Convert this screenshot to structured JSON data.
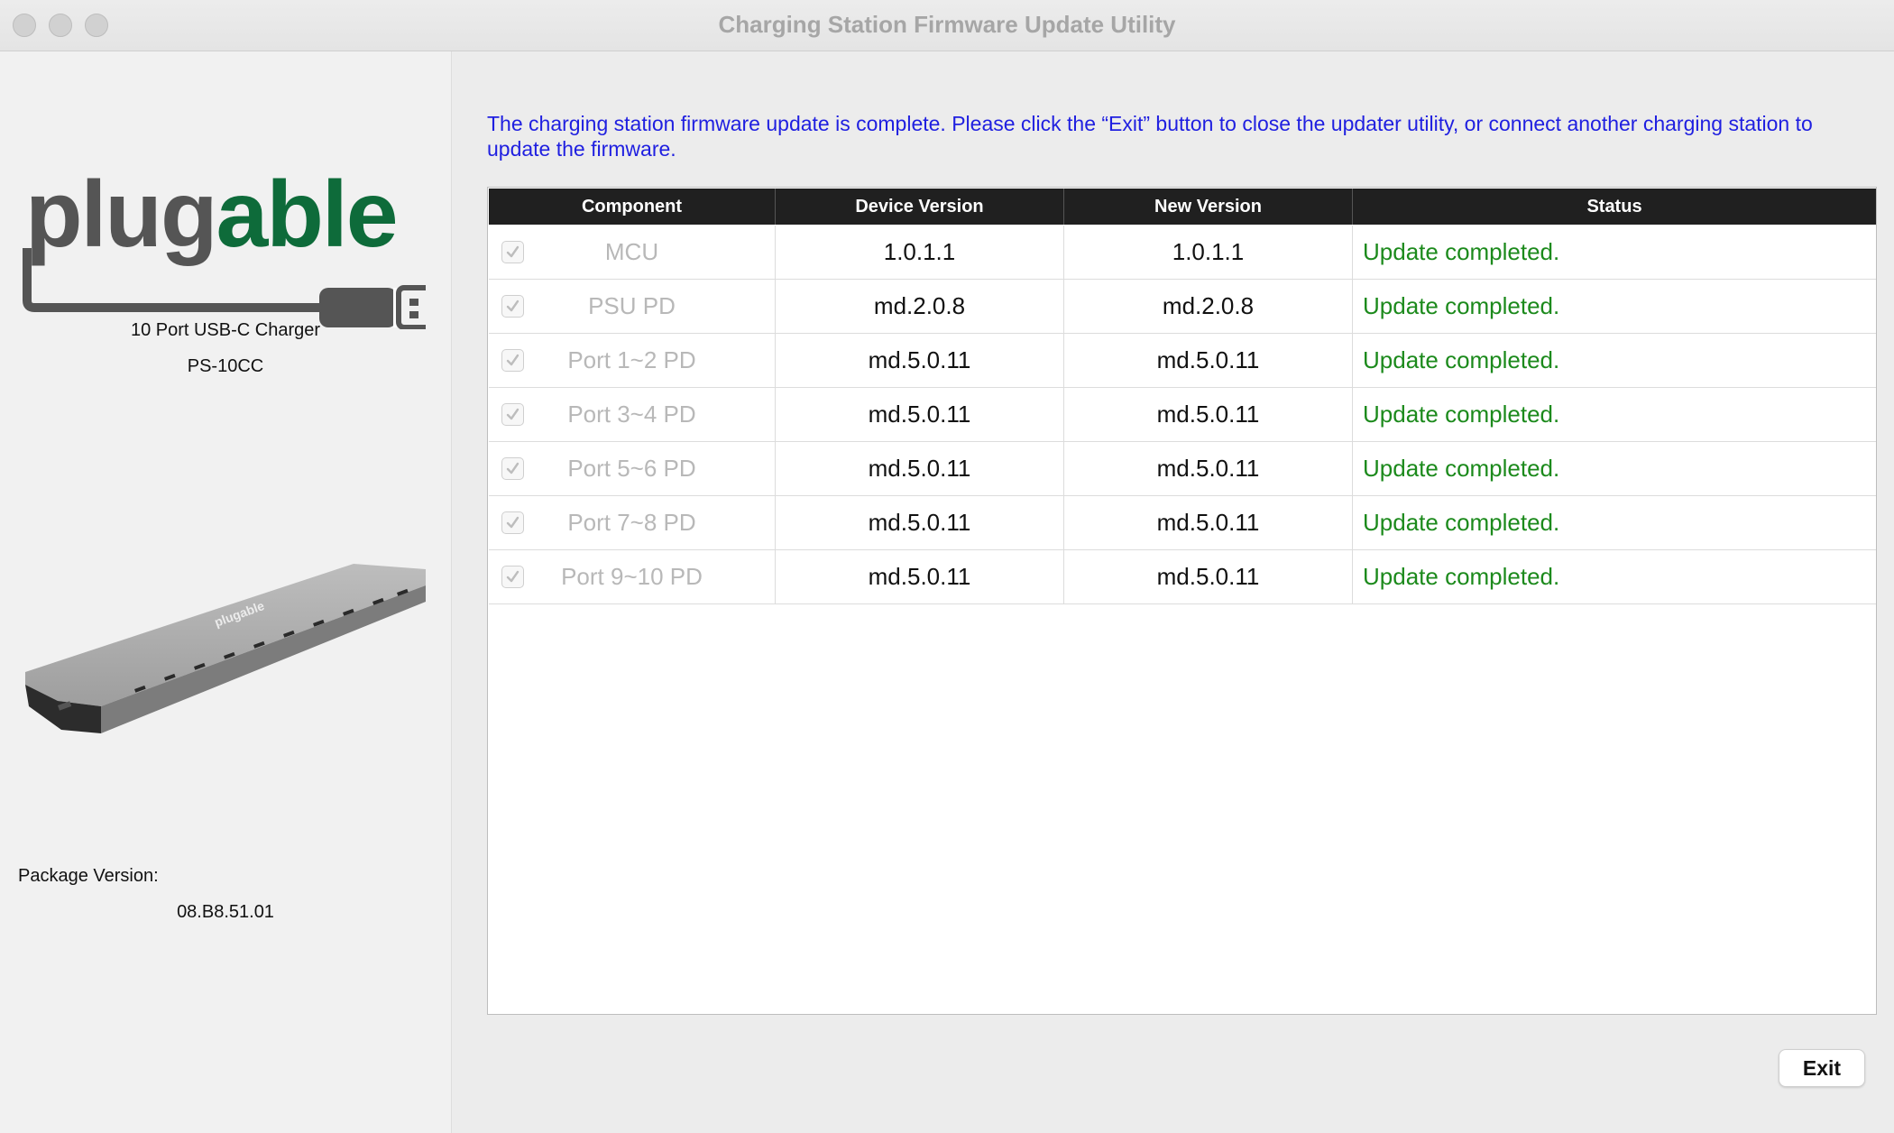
{
  "window": {
    "title": "Charging Station Firmware Update Utility"
  },
  "sidebar": {
    "brand": "plugable",
    "product_name": "10 Port USB-C Charger",
    "model": "PS-10CC",
    "package_label": "Package Version:",
    "package_version": "08.B8.51.01"
  },
  "main": {
    "message": "The charging station firmware update is complete. Please click the “Exit” button to close the updater utility, or connect another charging station to update the firmware."
  },
  "table": {
    "headers": [
      "Component",
      "Device Version",
      "New Version",
      "Status"
    ],
    "rows": [
      {
        "component": "MCU",
        "device_version": "1.0.1.1",
        "new_version": "1.0.1.1",
        "status": "Update completed.",
        "checked": true
      },
      {
        "component": "PSU PD",
        "device_version": "md.2.0.8",
        "new_version": "md.2.0.8",
        "status": "Update completed.",
        "checked": true
      },
      {
        "component": "Port 1~2 PD",
        "device_version": "md.5.0.11",
        "new_version": "md.5.0.11",
        "status": "Update completed.",
        "checked": true
      },
      {
        "component": "Port 3~4 PD",
        "device_version": "md.5.0.11",
        "new_version": "md.5.0.11",
        "status": "Update completed.",
        "checked": true
      },
      {
        "component": "Port 5~6 PD",
        "device_version": "md.5.0.11",
        "new_version": "md.5.0.11",
        "status": "Update completed.",
        "checked": true
      },
      {
        "component": "Port 7~8 PD",
        "device_version": "md.5.0.11",
        "new_version": "md.5.0.11",
        "status": "Update completed.",
        "checked": true
      },
      {
        "component": "Port 9~10 PD",
        "device_version": "md.5.0.11",
        "new_version": "md.5.0.11",
        "status": "Update completed.",
        "checked": true
      }
    ]
  },
  "footer": {
    "exit_label": "Exit"
  },
  "colors": {
    "message_text": "#1f1fe0",
    "status_ok": "#1c8a1c",
    "header_bg": "#202020",
    "brand_green": "#0e6b3a",
    "brand_gray": "#555555"
  }
}
